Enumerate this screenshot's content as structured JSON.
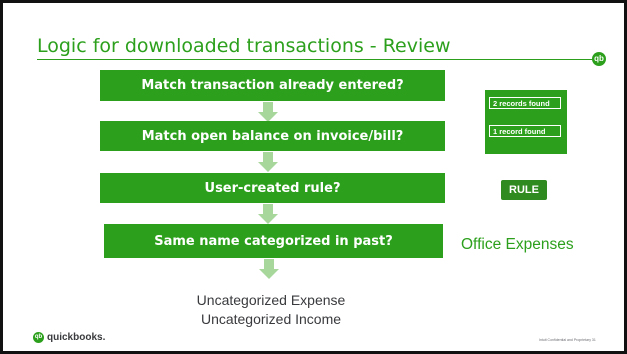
{
  "slide": {
    "title": "Logic for downloaded transactions - Review",
    "steps": [
      "Match transaction already entered?",
      "Match open balance on invoice/bill?",
      "User-created rule?",
      "Same name categorized in past?"
    ],
    "records": {
      "first": "2 records found",
      "second": "1 record found"
    },
    "rule_badge": "RULE",
    "office_expenses": "Office Expenses",
    "outcomes": [
      "Uncategorized Expense",
      "Uncategorized Income"
    ],
    "logo": {
      "brand": "quickbooks.",
      "mark": "qb"
    },
    "footer": "Intuit Confidential and Proprietary   31"
  },
  "colors": {
    "accent": "#2ca01c",
    "arrow": "#a8d79b",
    "text": "#393a3d"
  }
}
